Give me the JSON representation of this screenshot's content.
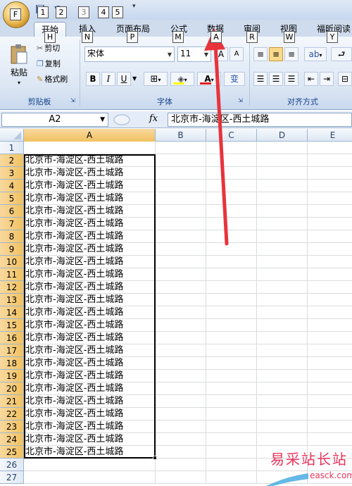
{
  "office_button": {
    "keytip": "F"
  },
  "qat": {
    "keytips": [
      "1",
      "2",
      "3",
      "4",
      "5"
    ]
  },
  "tabs": [
    {
      "label": "开始",
      "keytip": "H",
      "active": true
    },
    {
      "label": "插入",
      "keytip": "N"
    },
    {
      "label": "页面布局",
      "keytip": "P"
    },
    {
      "label": "公式",
      "keytip": "M"
    },
    {
      "label": "数据",
      "keytip": "A"
    },
    {
      "label": "审阅",
      "keytip": "R"
    },
    {
      "label": "视图",
      "keytip": "W"
    },
    {
      "label": "福昕阅读",
      "keytip": "Y"
    }
  ],
  "clipboard": {
    "paste": "粘贴",
    "cut": "剪切",
    "copy": "复制",
    "format_painter": "格式刷",
    "label": "剪贴板"
  },
  "font": {
    "name": "宋体",
    "size": "11",
    "label": "字体",
    "bold": "B",
    "italic": "I",
    "underline": "U",
    "grow": "A",
    "shrink": "A",
    "color_a": "A",
    "phonetic": "变"
  },
  "alignment": {
    "label": "对齐方式"
  },
  "formula_bar": {
    "name_box": "A2",
    "fx": "fx",
    "formula": "北京市-海淀区-西土城路"
  },
  "columns": [
    "A",
    "B",
    "C",
    "D",
    "E"
  ],
  "rows": [
    {
      "n": "1",
      "a": ""
    },
    {
      "n": "2",
      "a": "北京市-海淀区-西土城路"
    },
    {
      "n": "3",
      "a": "北京市-海淀区-西土城路"
    },
    {
      "n": "4",
      "a": "北京市-海淀区-西土城路"
    },
    {
      "n": "5",
      "a": "北京市-海淀区-西土城路"
    },
    {
      "n": "6",
      "a": "北京市-海淀区-西土城路"
    },
    {
      "n": "7",
      "a": "北京市-海淀区-西土城路"
    },
    {
      "n": "8",
      "a": "北京市-海淀区-西土城路"
    },
    {
      "n": "9",
      "a": "北京市-海淀区-西土城路"
    },
    {
      "n": "10",
      "a": "北京市-海淀区-西土城路"
    },
    {
      "n": "11",
      "a": "北京市-海淀区-西土城路"
    },
    {
      "n": "12",
      "a": "北京市-海淀区-西土城路"
    },
    {
      "n": "13",
      "a": "北京市-海淀区-西土城路"
    },
    {
      "n": "14",
      "a": "北京市-海淀区-西土城路"
    },
    {
      "n": "15",
      "a": "北京市-海淀区-西土城路"
    },
    {
      "n": "16",
      "a": "北京市-海淀区-西土城路"
    },
    {
      "n": "17",
      "a": "北京市-海淀区-西土城路"
    },
    {
      "n": "18",
      "a": "北京市-海淀区-西土城路"
    },
    {
      "n": "19",
      "a": "北京市-海淀区-西土城路"
    },
    {
      "n": "20",
      "a": "北京市-海淀区-西土城路"
    },
    {
      "n": "21",
      "a": "北京市-海淀区-西土城路"
    },
    {
      "n": "22",
      "a": "北京市-海淀区-西土城路"
    },
    {
      "n": "23",
      "a": "北京市-海淀区-西土城路"
    },
    {
      "n": "24",
      "a": "北京市-海淀区-西土城路"
    },
    {
      "n": "25",
      "a": "北京市-海淀区-西土城路"
    },
    {
      "n": "26",
      "a": ""
    },
    {
      "n": "27",
      "a": ""
    }
  ],
  "watermark": {
    "text": "易采站长站",
    "url": "easck.com"
  },
  "colors": {
    "selection_header": "#f1c15f",
    "arrow": "#e8333b",
    "watermark": "#e8335b"
  }
}
